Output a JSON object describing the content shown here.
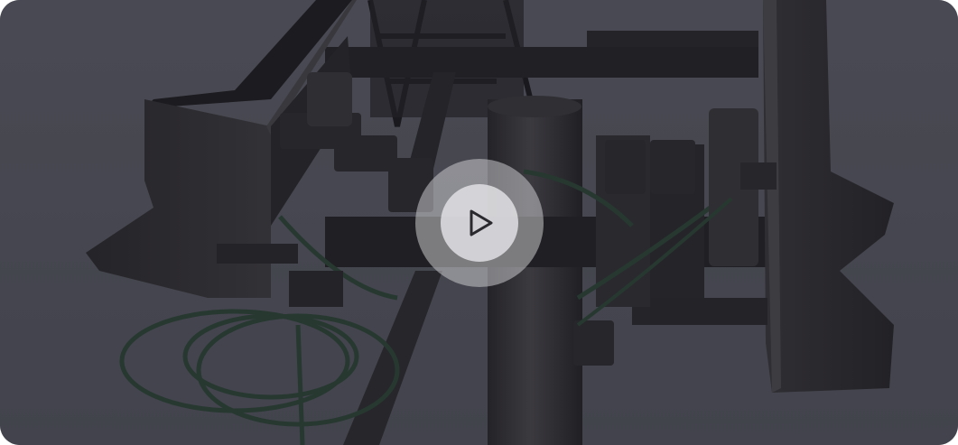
{
  "video": {
    "poster_description_icon": "cell-tower-antenna-image",
    "play_icon": "play-icon",
    "colors": {
      "sky": "#5b5c66",
      "metal_dark": "#1e1d1f",
      "metal_mid": "#3a393c",
      "cable_green": "#2f4a3c",
      "play_ring": "#c8c8cc",
      "play_center": "#e1e1e4",
      "play_glyph": "#2a2a2e"
    }
  }
}
